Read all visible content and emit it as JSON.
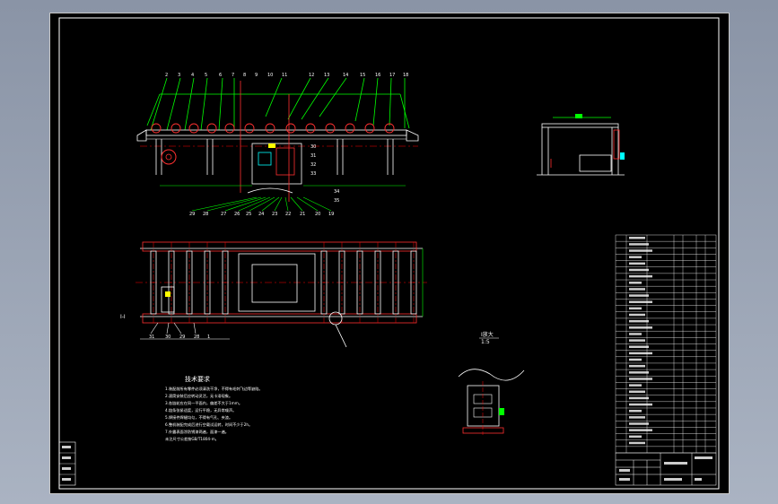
{
  "drawing": {
    "section_label": "I-I",
    "detail_label": "I放大",
    "detail_scale": "1:5",
    "tech_req_title": "技术要求",
    "tech_req_lines": [
      "1.装配前所有零件必须清洗干净，不得有毛刺飞边等缺陷。",
      "2.滚筒安装后应转动灵活，无卡滞现象。",
      "3.各链轮应在同一平面内，偏差不大于1mm。",
      "4.链条张紧适度，运行平稳，无异常噪声。",
      "5.焊接件焊缝均匀，不得有气孔、夹渣。",
      "6.整机装配完成后进行空载试运转，时间不少于2h。",
      "7.外露表面涂防锈漆两遍，面漆一遍。",
      "未注尺寸公差按GB/T1804-m。"
    ],
    "colors": {
      "background": "#000000",
      "line": "#ffffff",
      "dimension": "#00ff00",
      "center": "#ff0000",
      "label": "#ffff00",
      "part_body": "#ff3030"
    }
  }
}
